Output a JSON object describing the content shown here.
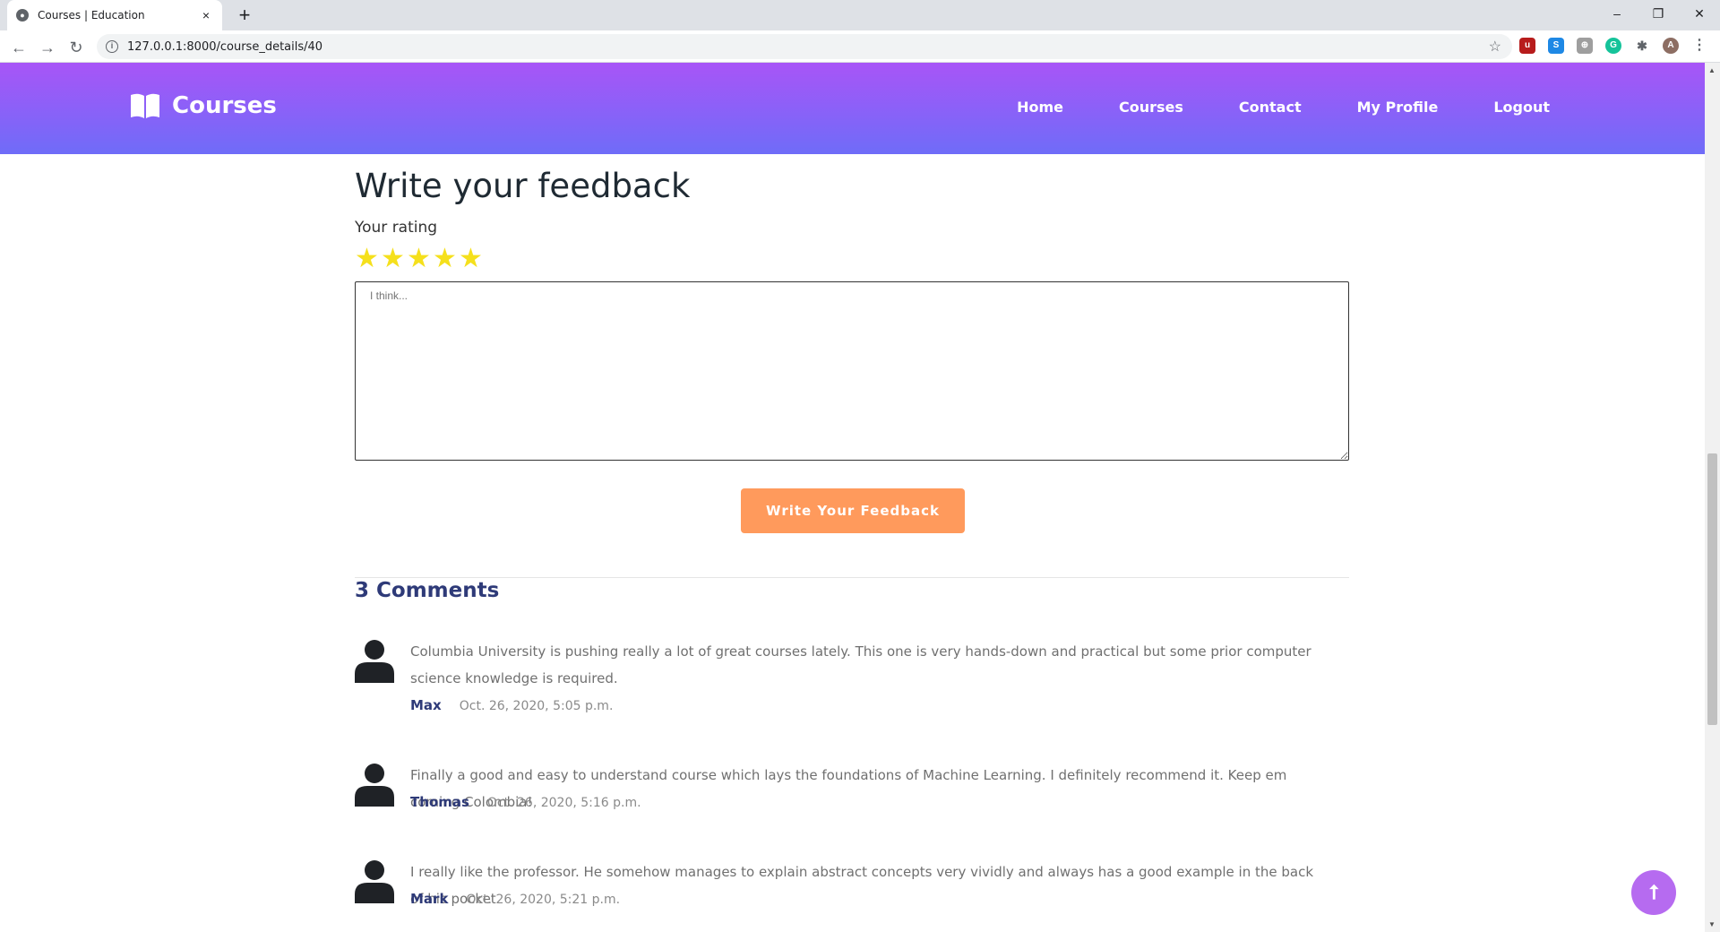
{
  "browser": {
    "tab_title": "Courses | Education",
    "tab_close": "×",
    "new_tab": "+",
    "url": "127.0.0.1:8000/course_details/40",
    "minimize": "–",
    "maximize": "❐",
    "close": "✕",
    "back": "←",
    "forward": "→",
    "reload": "↻",
    "star": "☆",
    "menu": "⋮",
    "profile_initial": "A"
  },
  "header": {
    "brand": "Courses",
    "nav": [
      "Home",
      "Courses",
      "Contact",
      "My Profile",
      "Logout"
    ]
  },
  "feedback": {
    "heading": "Write your feedback",
    "rating_label": "Your rating",
    "stars": [
      "★",
      "★",
      "★",
      "★",
      "★"
    ],
    "star_color": "#f5e01c",
    "placeholder": "I think...",
    "submit_label": "Write Your Feedback"
  },
  "comments": {
    "title": "3 Comments",
    "items": [
      {
        "text": "Columbia University is pushing really a lot of great courses lately. This one is very hands-down and practical but some prior computer science knowledge is required.",
        "author": "Max",
        "date": "Oct. 26, 2020, 5:05 p.m."
      },
      {
        "text": "Finally a good and easy to understand course which lays the foundations of Machine Learning. I definitely recommend it. Keep em coming Colombia!",
        "author": "Thomas",
        "date": "Oct. 26, 2020, 5:16 p.m."
      },
      {
        "text": "I really like the professor. He somehow manages to explain abstract concepts very vividly and always has a good example in the back of his pocket",
        "author": "Mark",
        "date": "Oct. 26, 2020, 5:21 p.m."
      }
    ]
  },
  "back_to_top": "⭡",
  "colors": {
    "header_top": "#a855f7",
    "header_bottom": "#6f6cf8",
    "button": "#ff9a5c",
    "comment_author": "#2e3a78"
  }
}
